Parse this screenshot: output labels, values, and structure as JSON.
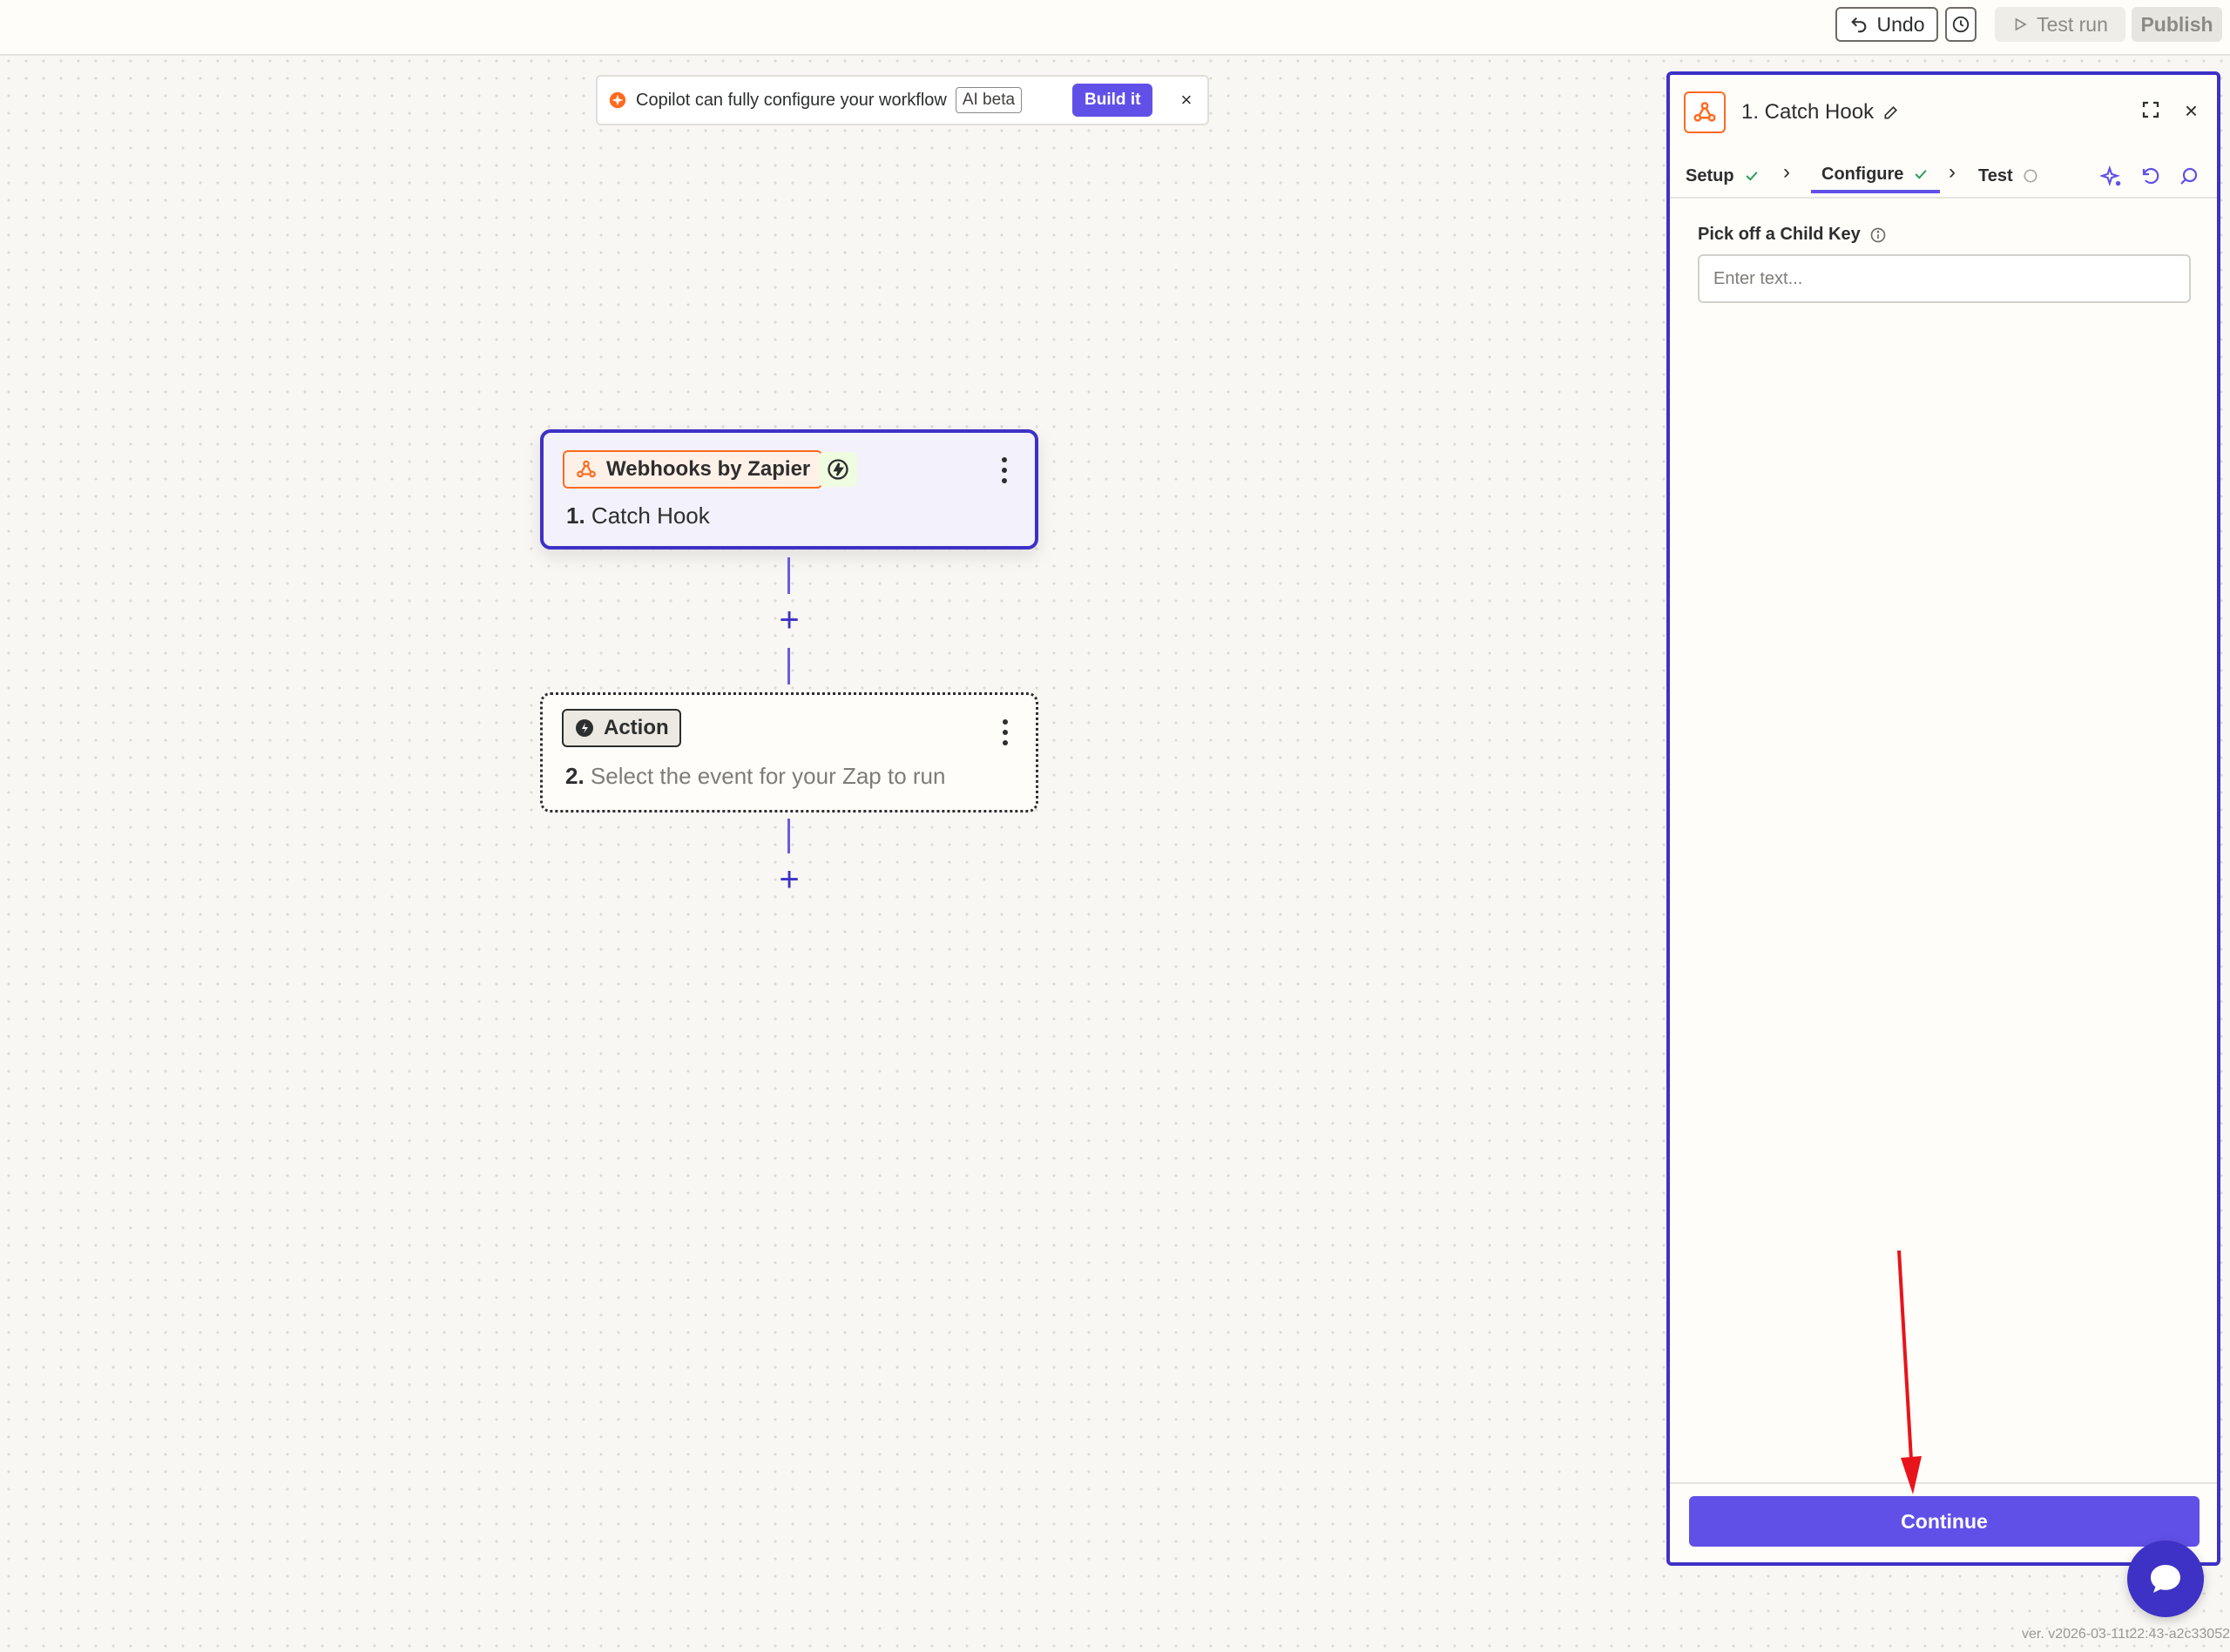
{
  "topbar": {
    "undo_label": "Undo",
    "test_run_label": "Test run",
    "publish_label": "Publish"
  },
  "copilot_banner": {
    "text": "Copilot can fully configure your workflow",
    "badge": "AI beta",
    "build_label": "Build it",
    "close_label": "×"
  },
  "canvas": {
    "trigger": {
      "app_name": "Webhooks by Zapier",
      "step_number": "1.",
      "step_title": "Catch Hook"
    },
    "action": {
      "chip_label": "Action",
      "step_number": "2.",
      "step_title": "Select the event for your Zap to run"
    },
    "add_step_symbol": "+"
  },
  "panel": {
    "title": "1. Catch Hook",
    "close_label": "×",
    "tabs": [
      {
        "label": "Setup",
        "status": "complete"
      },
      {
        "label": "Configure",
        "status": "complete"
      },
      {
        "label": "Test",
        "status": "pending"
      }
    ],
    "field": {
      "label": "Pick off a Child Key",
      "placeholder": "Enter text...",
      "value": ""
    },
    "continue_label": "Continue"
  },
  "version_text": "ver. v2026-03-11t22:43-a2c33052",
  "colors": {
    "brand_purple": "#6150e8",
    "selection_border": "#3d31c6",
    "zapier_orange": "#ff6a1f",
    "annotation_red": "#e8141b"
  },
  "annotation": {
    "type": "red-arrow",
    "points_to": "continue-button"
  }
}
